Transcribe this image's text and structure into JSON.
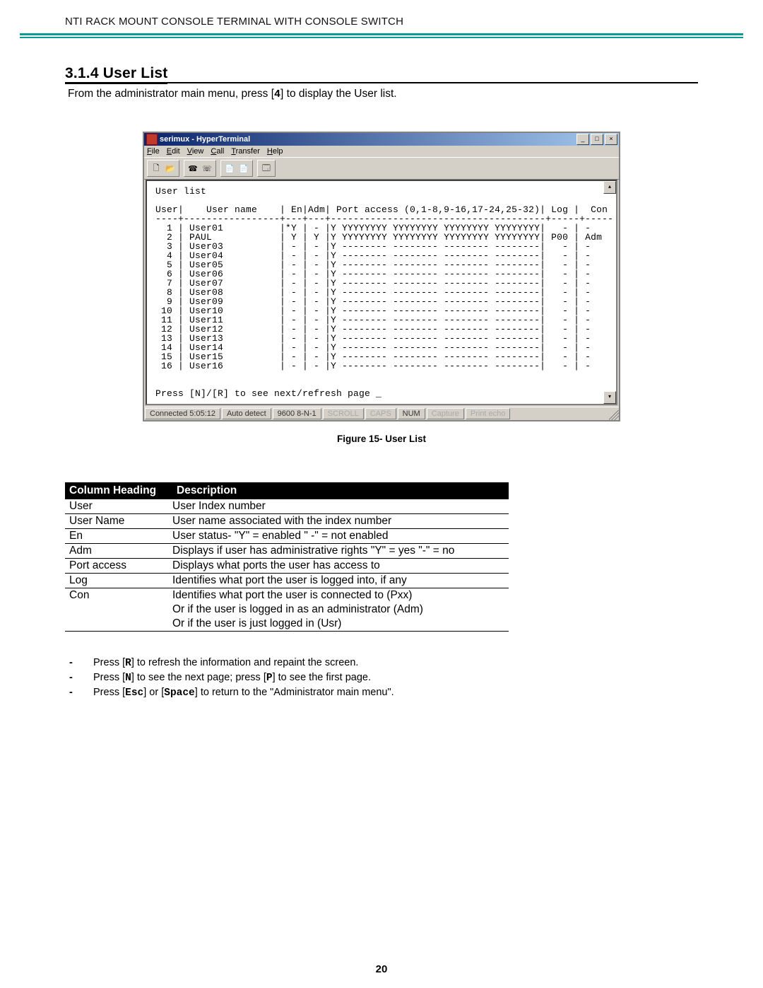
{
  "header": "NTI RACK MOUNT CONSOLE TERMINAL WITH CONSOLE SWITCH",
  "section_number": "3.1.4",
  "section_title": "User List",
  "intro_before": "From the administrator main menu,  press [",
  "intro_key": "4",
  "intro_after": "] to display the User list.",
  "window": {
    "title": "serimux - HyperTerminal",
    "menus": [
      "File",
      "Edit",
      "View",
      "Call",
      "Transfer",
      "Help"
    ],
    "toolbar_icons": [
      "new-file-icon",
      "open-icon",
      "||",
      "call-icon",
      "hangup-icon",
      "||",
      "send-icon",
      "receive-icon",
      "||",
      "properties-icon"
    ],
    "status": {
      "connected": "Connected 5:05:12",
      "autodetect": "Auto detect",
      "baud": "9600 8-N-1",
      "scroll": "SCROLL",
      "caps": "CAPS",
      "num": "NUM",
      "capture": "Capture",
      "echo": "Print echo"
    }
  },
  "terminal": {
    "title": "User list",
    "header": "User|    User name    | En|Adm| Port access (0,1-8,9-16,17-24,25-32)| Log |  Con",
    "rows": [
      {
        "n": " 1",
        "name": "User01",
        "en": "*Y",
        "adm": "-",
        "pa": "Y YYYYYYYY YYYYYYYY YYYYYYYY YYYYYYYY",
        "log": "-",
        "con": "-"
      },
      {
        "n": " 2",
        "name": "PAUL",
        "en": "Y",
        "adm": "Y",
        "pa": "Y YYYYYYYY YYYYYYYY YYYYYYYY YYYYYYYY",
        "log": "P00",
        "con": "Adm"
      },
      {
        "n": " 3",
        "name": "User03",
        "en": "-",
        "adm": "-",
        "pa": "Y -------- -------- -------- --------",
        "log": "-",
        "con": "-"
      },
      {
        "n": " 4",
        "name": "User04",
        "en": "-",
        "adm": "-",
        "pa": "Y -------- -------- -------- --------",
        "log": "-",
        "con": "-"
      },
      {
        "n": " 5",
        "name": "User05",
        "en": "-",
        "adm": "-",
        "pa": "Y -------- -------- -------- --------",
        "log": "-",
        "con": "-"
      },
      {
        "n": " 6",
        "name": "User06",
        "en": "-",
        "adm": "-",
        "pa": "Y -------- -------- -------- --------",
        "log": "-",
        "con": "-"
      },
      {
        "n": " 7",
        "name": "User07",
        "en": "-",
        "adm": "-",
        "pa": "Y -------- -------- -------- --------",
        "log": "-",
        "con": "-"
      },
      {
        "n": " 8",
        "name": "User08",
        "en": "-",
        "adm": "-",
        "pa": "Y -------- -------- -------- --------",
        "log": "-",
        "con": "-"
      },
      {
        "n": " 9",
        "name": "User09",
        "en": "-",
        "adm": "-",
        "pa": "Y -------- -------- -------- --------",
        "log": "-",
        "con": "-"
      },
      {
        "n": "10",
        "name": "User10",
        "en": "-",
        "adm": "-",
        "pa": "Y -------- -------- -------- --------",
        "log": "-",
        "con": "-"
      },
      {
        "n": "11",
        "name": "User11",
        "en": "-",
        "adm": "-",
        "pa": "Y -------- -------- -------- --------",
        "log": "-",
        "con": "-"
      },
      {
        "n": "12",
        "name": "User12",
        "en": "-",
        "adm": "-",
        "pa": "Y -------- -------- -------- --------",
        "log": "-",
        "con": "-"
      },
      {
        "n": "13",
        "name": "User13",
        "en": "-",
        "adm": "-",
        "pa": "Y -------- -------- -------- --------",
        "log": "-",
        "con": "-"
      },
      {
        "n": "14",
        "name": "User14",
        "en": "-",
        "adm": "-",
        "pa": "Y -------- -------- -------- --------",
        "log": "-",
        "con": "-"
      },
      {
        "n": "15",
        "name": "User15",
        "en": "-",
        "adm": "-",
        "pa": "Y -------- -------- -------- --------",
        "log": "-",
        "con": "-"
      },
      {
        "n": "16",
        "name": "User16",
        "en": "-",
        "adm": "-",
        "pa": "Y -------- -------- -------- --------",
        "log": "-",
        "con": "-"
      }
    ],
    "footer": "Press [N]/[R] to see next/refresh page _"
  },
  "figure_caption": "Figure 15- User List",
  "table": {
    "h1": "Column Heading",
    "h2": "Description",
    "rows": [
      {
        "c": "User",
        "d": "User Index number"
      },
      {
        "c": "User Name",
        "d": "User name associated with the index number"
      },
      {
        "c": "En",
        "d": "User status- \"Y\" = enabled   \" -\" = not enabled"
      },
      {
        "c": "Adm",
        "d": "Displays if user has administrative rights   \"Y\" = yes   \"-\" = no"
      },
      {
        "c": "Port access",
        "d": "Displays what ports the user has access to"
      },
      {
        "c": "Log",
        "d": "Identifies what port the user is logged into, if any"
      },
      {
        "c": "Con",
        "d": "Identifies what port the user is connected to (Pxx)\nOr if the user is logged in as an administrator (Adm)\nOr if the user is just logged in (Usr)"
      }
    ]
  },
  "notes": [
    {
      "pre": "Press [",
      "k": "R",
      "post": "] to refresh the information and repaint the screen."
    },
    {
      "pre": "Press [",
      "k": "N",
      "post1": "] to see the next page; press [",
      "k2": "P",
      "post2": "] to see the first page."
    },
    {
      "pre": "Press [",
      "k": "Esc",
      "post1": "] or [",
      "k2": "Space",
      "post2": "] to return to the \"Administrator main menu\"."
    }
  ],
  "page_number": "20"
}
